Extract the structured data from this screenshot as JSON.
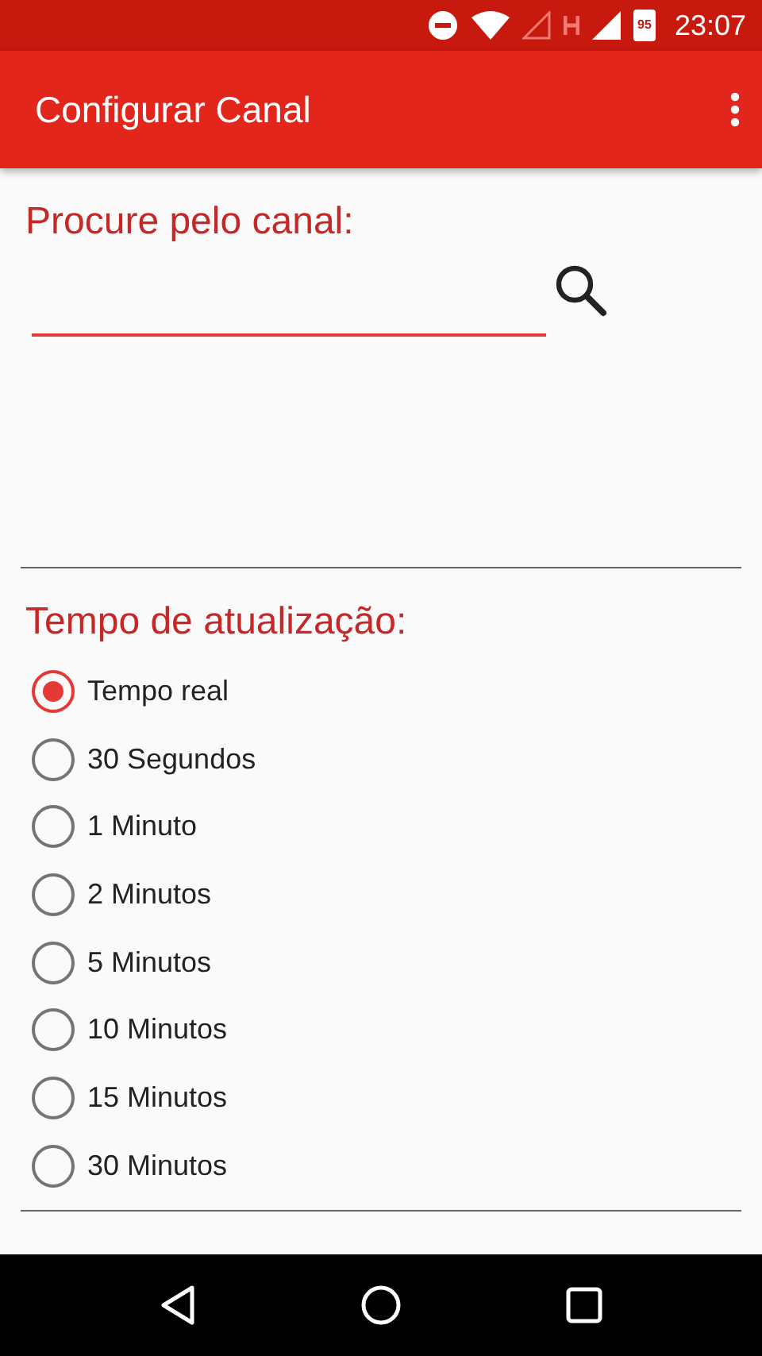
{
  "status_bar": {
    "battery": "95",
    "time": "23:07"
  },
  "app_bar": {
    "title": "Configurar Canal"
  },
  "search": {
    "label": "Procure pelo canal:"
  },
  "refresh": {
    "label": "Tempo de atualização:",
    "options": [
      {
        "label": "Tempo real",
        "selected": true
      },
      {
        "label": "30 Segundos",
        "selected": false
      },
      {
        "label": "1 Minuto",
        "selected": false
      },
      {
        "label": "2 Minutos",
        "selected": false
      },
      {
        "label": "5 Minutos",
        "selected": false
      },
      {
        "label": "10 Minutos",
        "selected": false
      },
      {
        "label": "15 Minutos",
        "selected": false
      },
      {
        "label": "30 Minutos",
        "selected": false
      }
    ]
  }
}
